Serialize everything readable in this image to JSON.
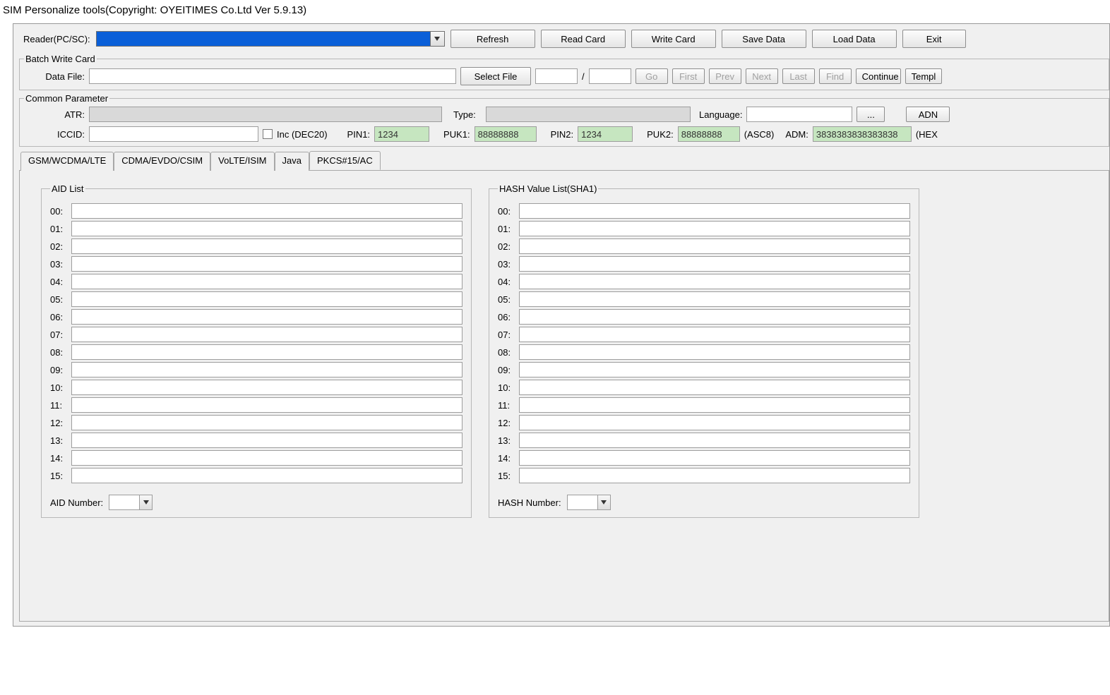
{
  "title": "SIM Personalize tools(Copyright: OYEITIMES Co.Ltd  Ver 5.9.13)",
  "toolbar": {
    "reader_label": "Reader(PC/SC):",
    "reader_value": "",
    "refresh": "Refresh",
    "read_card": "Read Card",
    "write_card": "Write Card",
    "save_data": "Save Data",
    "load_data": "Load Data",
    "exit": "Exit"
  },
  "batch": {
    "legend": "Batch Write Card",
    "data_file_label": "Data File:",
    "data_file_value": "",
    "select_file": "Select File",
    "idx_a": "",
    "idx_sep": "/",
    "idx_b": "",
    "go": "Go",
    "first": "First",
    "prev": "Prev",
    "next": "Next",
    "last": "Last",
    "find": "Find",
    "continue": "Continue",
    "template": "Templ"
  },
  "common": {
    "legend": "Common Parameter",
    "atr_label": "ATR:",
    "atr_value": "",
    "type_label": "Type:",
    "type_value": "",
    "language_label": "Language:",
    "language_value": "",
    "language_browse": "...",
    "adn": "ADN",
    "iccid_label": "ICCID:",
    "iccid_value": "",
    "inc_label": "Inc  (DEC20)",
    "pin1_label": "PIN1:",
    "pin1_value": "1234",
    "puk1_label": "PUK1:",
    "puk1_value": "88888888",
    "pin2_label": "PIN2:",
    "pin2_value": "1234",
    "puk2_label": "PUK2:",
    "puk2_value": "88888888",
    "asc8": "(ASC8)",
    "adm_label": "ADM:",
    "adm_value": "3838383838383838",
    "hex": "(HEX"
  },
  "tabs": {
    "t0": "GSM/WCDMA/LTE",
    "t1": "CDMA/EVDO/CSIM",
    "t2": "VoLTE/ISIM",
    "t3": "Java",
    "t4": "PKCS#15/AC"
  },
  "aid": {
    "legend": "AID List",
    "rows": [
      {
        "label": "00:",
        "value": ""
      },
      {
        "label": "01:",
        "value": ""
      },
      {
        "label": "02:",
        "value": ""
      },
      {
        "label": "03:",
        "value": ""
      },
      {
        "label": "04:",
        "value": ""
      },
      {
        "label": "05:",
        "value": ""
      },
      {
        "label": "06:",
        "value": ""
      },
      {
        "label": "07:",
        "value": ""
      },
      {
        "label": "08:",
        "value": ""
      },
      {
        "label": "09:",
        "value": ""
      },
      {
        "label": "10:",
        "value": ""
      },
      {
        "label": "11:",
        "value": ""
      },
      {
        "label": "12:",
        "value": ""
      },
      {
        "label": "13:",
        "value": ""
      },
      {
        "label": "14:",
        "value": ""
      },
      {
        "label": "15:",
        "value": ""
      }
    ],
    "number_label": "AID Number:",
    "number_value": ""
  },
  "hash": {
    "legend": "HASH Value List(SHA1)",
    "rows": [
      {
        "label": "00:",
        "value": ""
      },
      {
        "label": "01:",
        "value": ""
      },
      {
        "label": "02:",
        "value": ""
      },
      {
        "label": "03:",
        "value": ""
      },
      {
        "label": "04:",
        "value": ""
      },
      {
        "label": "05:",
        "value": ""
      },
      {
        "label": "06:",
        "value": ""
      },
      {
        "label": "07:",
        "value": ""
      },
      {
        "label": "08:",
        "value": ""
      },
      {
        "label": "09:",
        "value": ""
      },
      {
        "label": "10:",
        "value": ""
      },
      {
        "label": "11:",
        "value": ""
      },
      {
        "label": "12:",
        "value": ""
      },
      {
        "label": "13:",
        "value": ""
      },
      {
        "label": "14:",
        "value": ""
      },
      {
        "label": "15:",
        "value": ""
      }
    ],
    "number_label": "HASH Number:",
    "number_value": ""
  }
}
